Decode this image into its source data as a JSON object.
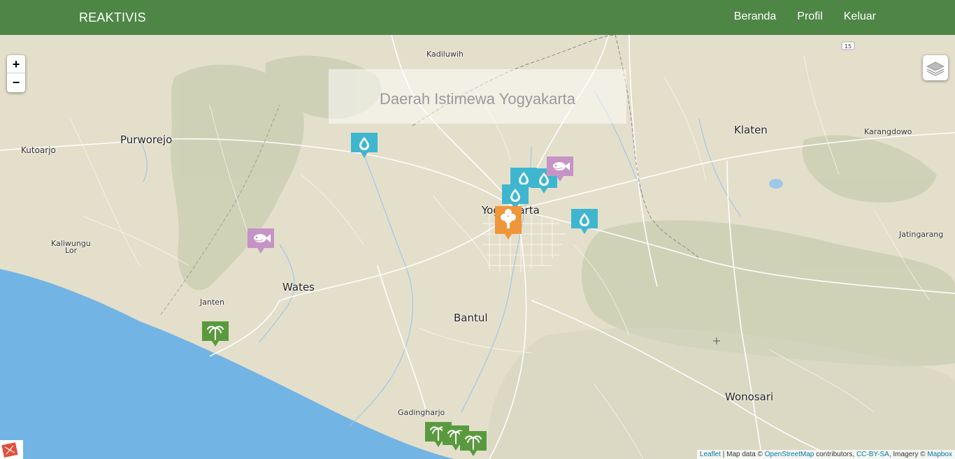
{
  "navbar": {
    "brand": "REAKTIVIS",
    "links": [
      "Beranda",
      "Profil",
      "Keluar"
    ],
    "color": "#4e8646"
  },
  "map": {
    "region_label": "Daerah Istimewa Yogyakarta",
    "zoom_in": "+",
    "zoom_out": "−",
    "road_shield": "15",
    "places": {
      "kadiluwih": "Kadiluwih",
      "klaten": "Klaten",
      "karangdowo": "Karangdowo",
      "purworejo": "Purworejo",
      "kutoarjo": "Kutoarjo",
      "yogyakarta": "Yogyakarta",
      "kaliwungu": "Kaliwungu",
      "lor": "Lor",
      "wates": "Wates",
      "jatingarang": "Jatingarang",
      "janten": "Janten",
      "bantul": "Bantul",
      "wonosari": "Wonosari",
      "gadingharjo": "Gadingharjo"
    },
    "marker_types": {
      "water": {
        "icon": "water-drop-icon",
        "color": "#3fb6cf"
      },
      "fish": {
        "icon": "fish-icon",
        "color": "#c594c5"
      },
      "tree": {
        "icon": "tree-icon",
        "color": "#f0963a"
      },
      "palm": {
        "icon": "palm-tree-icon",
        "color": "#5a9a3f"
      }
    },
    "attribution": {
      "leaflet": "Leaflet",
      "sep": " | Map data © ",
      "osm": "OpenStreetMap",
      "contrib": " contributors, ",
      "license": "CC-BY-SA",
      "imagery": ", Imagery © ",
      "mapbox": "Mapbox"
    },
    "sea_color": "#72b4e3"
  }
}
